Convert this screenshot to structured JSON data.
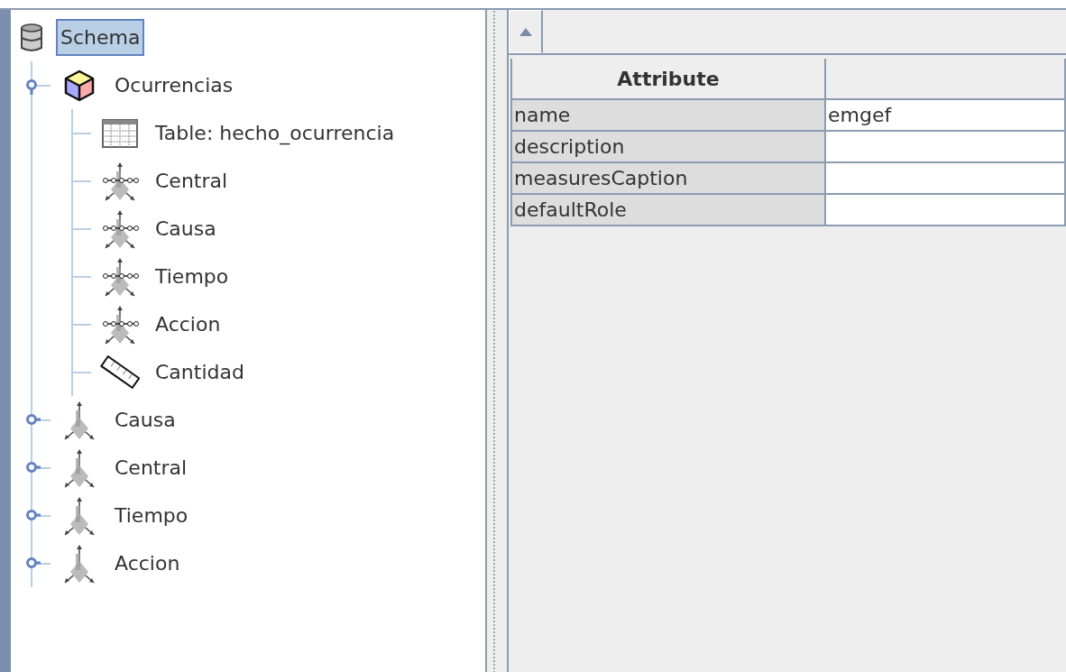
{
  "tree": {
    "label": "Schema",
    "kind": "schema",
    "selected": true,
    "children": [
      {
        "label": "Ocurrencias",
        "kind": "cube",
        "selected": false,
        "expanded": true,
        "children": [
          {
            "label": "Table: hecho_ocurrencia",
            "kind": "table",
            "selected": false
          },
          {
            "label": "Central",
            "kind": "dimension-usage",
            "selected": false
          },
          {
            "label": "Causa",
            "kind": "dimension-usage",
            "selected": false
          },
          {
            "label": "Tiempo",
            "kind": "dimension-usage",
            "selected": false
          },
          {
            "label": "Accion",
            "kind": "dimension-usage",
            "selected": false
          },
          {
            "label": "Cantidad",
            "kind": "measure",
            "selected": false
          }
        ]
      },
      {
        "label": "Causa",
        "kind": "dimension",
        "selected": false,
        "expanded": false
      },
      {
        "label": "Central",
        "kind": "dimension",
        "selected": false,
        "expanded": false
      },
      {
        "label": "Tiempo",
        "kind": "dimension",
        "selected": false,
        "expanded": false
      },
      {
        "label": "Accion",
        "kind": "dimension",
        "selected": false,
        "expanded": false
      }
    ]
  },
  "table": {
    "columns": [
      "Attribute"
    ],
    "rows": [
      {
        "attribute": "name",
        "value": "emgef"
      },
      {
        "attribute": "description"
      },
      {
        "attribute": "measuresCaption"
      },
      {
        "attribute": "defaultRole"
      }
    ]
  }
}
